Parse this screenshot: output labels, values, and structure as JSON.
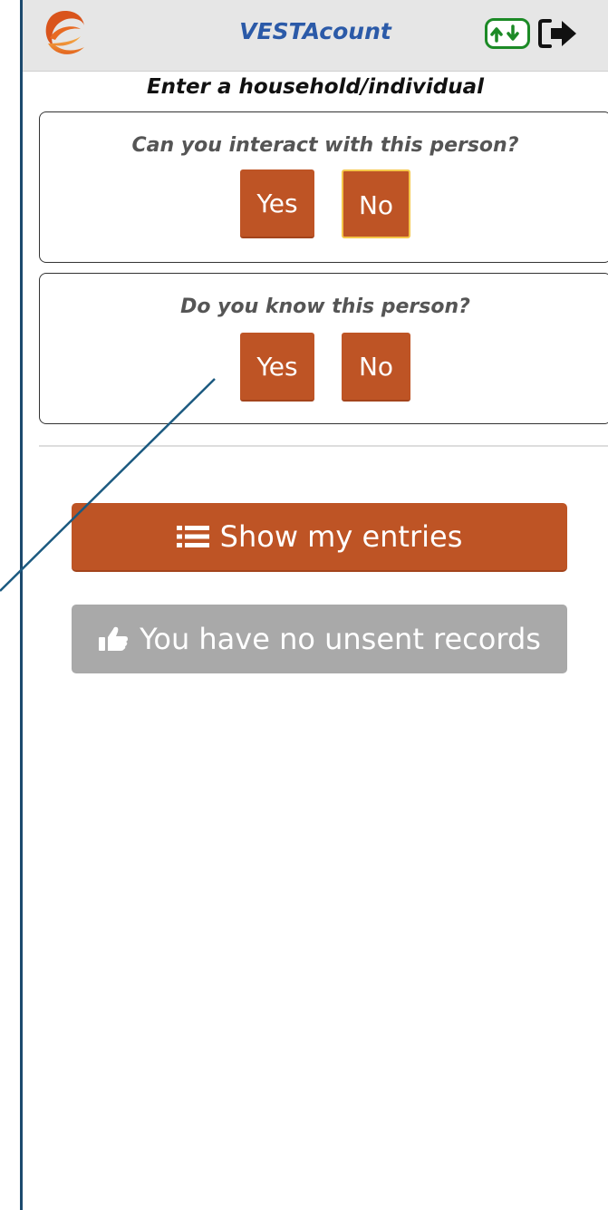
{
  "header": {
    "app_title": "VESTAcount",
    "logo_icon": "vesta-logo-icon",
    "sync_icon": "up-down-arrows-icon",
    "logout_icon": "logout-arrow-icon"
  },
  "main": {
    "heading": "Enter a household/individual",
    "interact_question": {
      "text": "Can you interact with this person?",
      "yes_label": "Yes",
      "no_label": "No"
    },
    "know_question": {
      "text": "Do you know this person?",
      "yes_label": "Yes",
      "no_label": "No"
    },
    "show_entries_label": "Show my entries",
    "show_entries_icon": "list-icon",
    "unsent_label": "You have no unsent records",
    "unsent_icon": "thumbs-up-icon"
  },
  "colors": {
    "accent": "#be5425",
    "title": "#2b5aa8",
    "sync_border": "#1c8a26",
    "disabled_button": "#a9a9a9"
  }
}
